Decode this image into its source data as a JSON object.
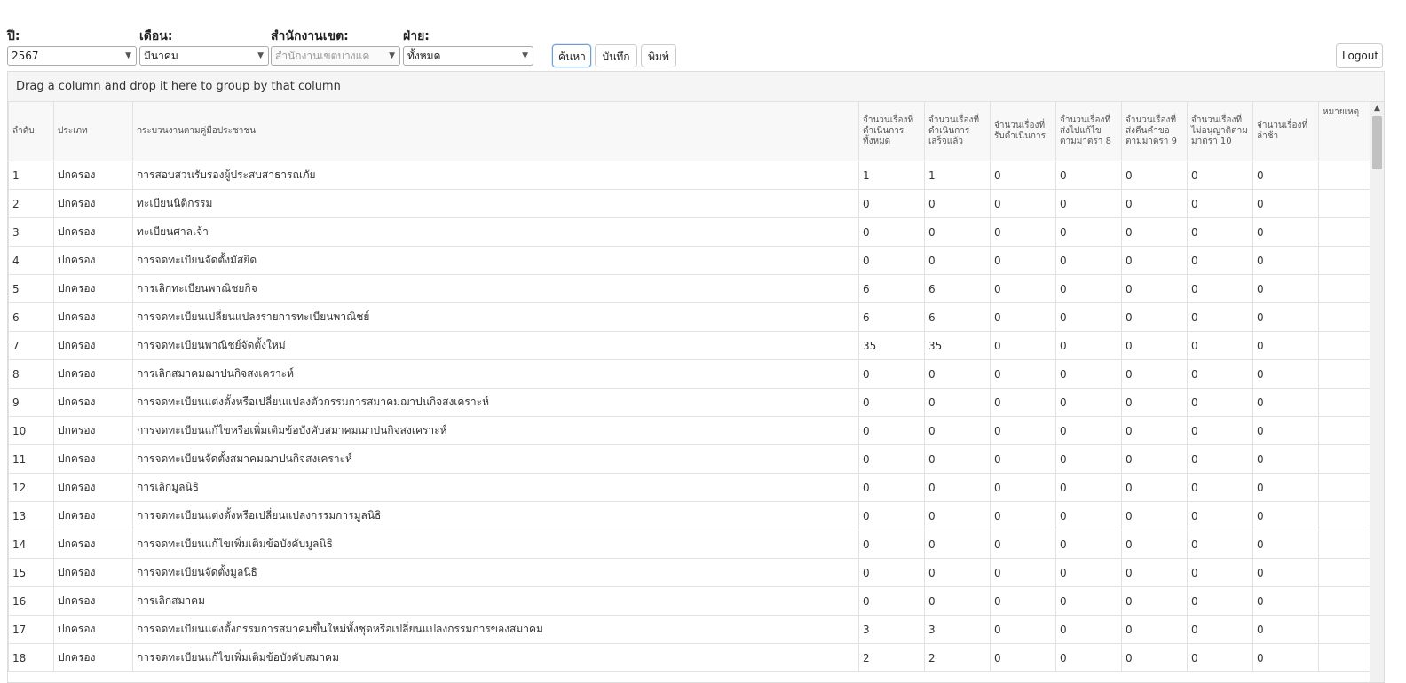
{
  "filters": {
    "year": {
      "label": "ปี:",
      "value": "2567"
    },
    "month": {
      "label": "เดือน:",
      "value": "มีนาคม"
    },
    "district": {
      "label": "สำนักงานเขต:",
      "value": "สำนักงานเขตบางแค"
    },
    "division": {
      "label": "ฝ่าย:",
      "value": "ทั้งหมด"
    }
  },
  "toolbar": {
    "search_label": "ค้นหา",
    "save_label": "บันทึก",
    "print_label": "พิมพ์",
    "logout_label": "Logout"
  },
  "grid": {
    "group_panel_text": "Drag a column and drop it here to group by that column",
    "headers": [
      "ลำดับ",
      "ประเภท",
      "กระบวนงานตามคู่มือประชาชน",
      "จำนวนเรื่องที่ดำเนินการทั้งหมด",
      "จำนวนเรื่องที่ดำเนินการเสร็จแล้ว",
      "จำนวนเรื่องที่รับดำเนินการ",
      "จำนวนเรื่องที่ส่งไปแก้ไขตามมาตรา 8",
      "จำนวนเรื่องที่ส่งคืนคำขอตามมาตรา 9",
      "จำนวนเรื่องที่ไม่อนุญาติตามมาตรา 10",
      "จำนวนเรื่องที่ล่าช้า",
      "หมายเหตุ"
    ],
    "rows": [
      [
        "1",
        "ปกครอง",
        "การสอบสวนรับรองผู้ประสบสาธารณภัย",
        "1",
        "1",
        "0",
        "0",
        "0",
        "0",
        "0",
        ""
      ],
      [
        "2",
        "ปกครอง",
        "ทะเบียนนิติกรรม",
        "0",
        "0",
        "0",
        "0",
        "0",
        "0",
        "0",
        ""
      ],
      [
        "3",
        "ปกครอง",
        "ทะเบียนศาลเจ้า",
        "0",
        "0",
        "0",
        "0",
        "0",
        "0",
        "0",
        ""
      ],
      [
        "4",
        "ปกครอง",
        "การจดทะเบียนจัดตั้งมัสยิด",
        "0",
        "0",
        "0",
        "0",
        "0",
        "0",
        "0",
        ""
      ],
      [
        "5",
        "ปกครอง",
        "การเลิกทะเบียนพาณิชยกิจ",
        "6",
        "6",
        "0",
        "0",
        "0",
        "0",
        "0",
        ""
      ],
      [
        "6",
        "ปกครอง",
        "การจดทะเบียนเปลี่ยนแปลงรายการทะเบียนพาณิชย์",
        "6",
        "6",
        "0",
        "0",
        "0",
        "0",
        "0",
        ""
      ],
      [
        "7",
        "ปกครอง",
        "การจดทะเบียนพาณิชย์จัดตั้งใหม่",
        "35",
        "35",
        "0",
        "0",
        "0",
        "0",
        "0",
        ""
      ],
      [
        "8",
        "ปกครอง",
        "การเลิกสมาคมฌาปนกิจสงเคราะห์",
        "0",
        "0",
        "0",
        "0",
        "0",
        "0",
        "0",
        ""
      ],
      [
        "9",
        "ปกครอง",
        "การจดทะเบียนแต่งตั้งหรือเปลี่ยนแปลงตัวกรรมการสมาคมฌาปนกิจสงเคราะห์",
        "0",
        "0",
        "0",
        "0",
        "0",
        "0",
        "0",
        ""
      ],
      [
        "10",
        "ปกครอง",
        "การจดทะเบียนแก้ไขหรือเพิ่มเติมข้อบังคับสมาคมฌาปนกิจสงเคราะห์",
        "0",
        "0",
        "0",
        "0",
        "0",
        "0",
        "0",
        ""
      ],
      [
        "11",
        "ปกครอง",
        "การจดทะเบียนจัดตั้งสมาคมฌาปนกิจสงเคราะห์",
        "0",
        "0",
        "0",
        "0",
        "0",
        "0",
        "0",
        ""
      ],
      [
        "12",
        "ปกครอง",
        "การเลิกมูลนิธิ",
        "0",
        "0",
        "0",
        "0",
        "0",
        "0",
        "0",
        ""
      ],
      [
        "13",
        "ปกครอง",
        "การจดทะเบียนแต่งตั้งหรือเปลี่ยนแปลงกรรมการมูลนิธิ",
        "0",
        "0",
        "0",
        "0",
        "0",
        "0",
        "0",
        ""
      ],
      [
        "14",
        "ปกครอง",
        "การจดทะเบียนแก้ไขเพิ่มเติมข้อบังคับมูลนิธิ",
        "0",
        "0",
        "0",
        "0",
        "0",
        "0",
        "0",
        ""
      ],
      [
        "15",
        "ปกครอง",
        "การจดทะเบียนจัดตั้งมูลนิธิ",
        "0",
        "0",
        "0",
        "0",
        "0",
        "0",
        "0",
        ""
      ],
      [
        "16",
        "ปกครอง",
        "การเลิกสมาคม",
        "0",
        "0",
        "0",
        "0",
        "0",
        "0",
        "0",
        ""
      ],
      [
        "17",
        "ปกครอง",
        "การจดทะเบียนแต่งตั้งกรรมการสมาคมขึ้นใหม่ทั้งชุดหรือเปลี่ยนแปลงกรรมการของสมาคม",
        "3",
        "3",
        "0",
        "0",
        "0",
        "0",
        "0",
        ""
      ],
      [
        "18",
        "ปกครอง",
        "การจดทะเบียนแก้ไขเพิ่มเติมข้อบังคับสมาคม",
        "2",
        "2",
        "0",
        "0",
        "0",
        "0",
        "0",
        ""
      ]
    ]
  }
}
